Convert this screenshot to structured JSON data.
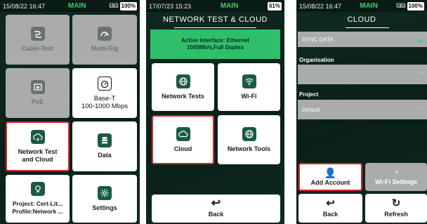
{
  "screen1": {
    "status": {
      "time": "15/08/22 16:47",
      "mode": "MAIN",
      "battery": "100%"
    },
    "tiles": {
      "cable_test": "Cable-Test",
      "multi_gig": "Multi-Gig",
      "poe": "PoE",
      "base_t": "Base-T\n100-1000 Mbps",
      "network_test_cloud": "Network Test\nand Cloud",
      "data": "Data",
      "project": "Project: Cert-Lit...\nProfile:Network ...",
      "settings": "Settings"
    }
  },
  "screen2": {
    "status": {
      "time": "17/07/23 15:23",
      "mode": "MAIN",
      "battery": "61%"
    },
    "title": "NETWORK TEST & CLOUD",
    "banner_line1": "Active Interface: Ethernet",
    "banner_line2": "1000Mb/s,Full Duplex",
    "tiles": {
      "network_tests": "Network Tests",
      "wifi": "Wi-Fi",
      "cloud": "Cloud",
      "network_tools": "Network Tools",
      "back": "Back"
    }
  },
  "screen3": {
    "status": {
      "time": "15/08/22 16:47",
      "mode": "MAIN",
      "battery": "100%"
    },
    "title": "CLOUD",
    "sync_data": "SYNC DATA",
    "organisation_label": "Organisation",
    "project_label": "Project",
    "project_value": "Default",
    "tiles": {
      "add_account": "Add Account",
      "wifi_settings": "Wi-Fi Settings",
      "back": "Back",
      "refresh": "Refresh"
    }
  },
  "colors": {
    "accent": "#1a5a44",
    "selected_outline": "#d9262e",
    "banner": "#2fbf6b",
    "mode_text": "#39d06e"
  }
}
